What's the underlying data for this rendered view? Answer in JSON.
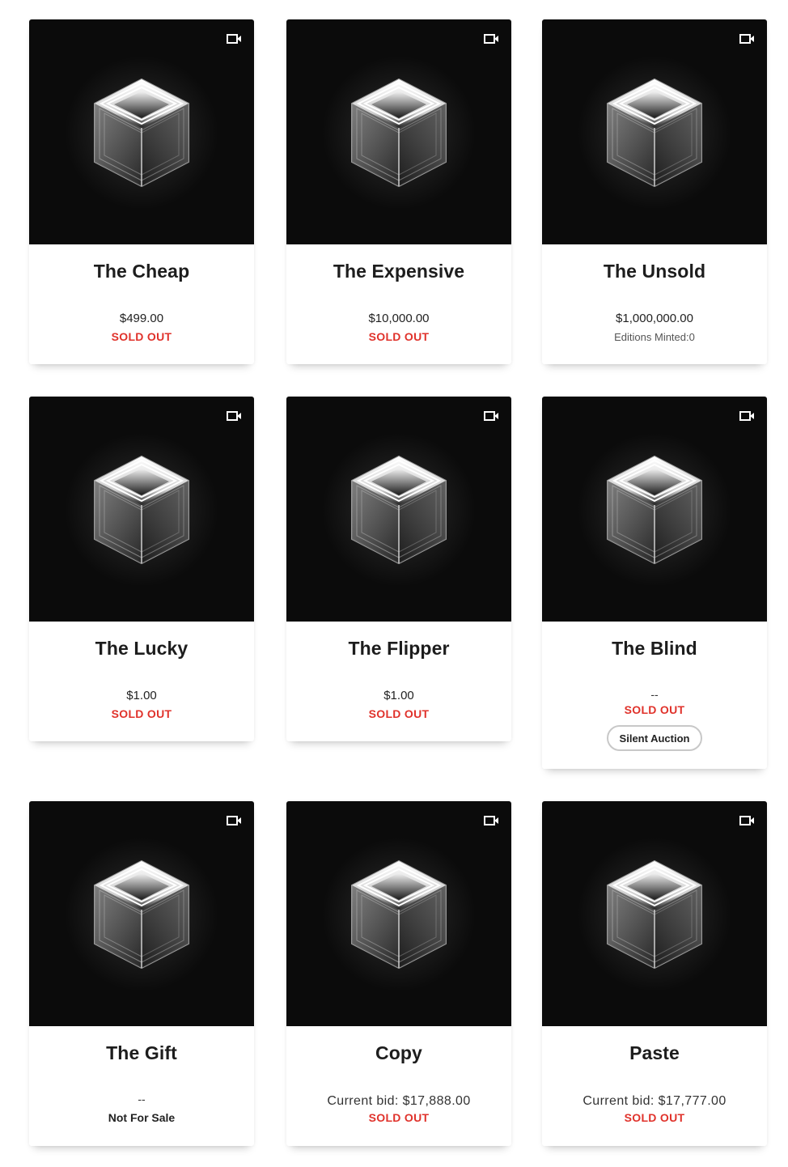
{
  "items": [
    {
      "title": "The Cheap",
      "price": "$499.00",
      "status": "SOLD OUT"
    },
    {
      "title": "The Expensive",
      "price": "$10,000.00",
      "status": "SOLD OUT"
    },
    {
      "title": "The Unsold",
      "price": "$1,000,000.00",
      "editions": "Editions Minted:0"
    },
    {
      "title": "The Lucky",
      "price": "$1.00",
      "status": "SOLD OUT"
    },
    {
      "title": "The Flipper",
      "price": "$1.00",
      "status": "SOLD OUT"
    },
    {
      "title": "The Blind",
      "price": "--",
      "status": "SOLD OUT",
      "tag": "Silent Auction"
    },
    {
      "title": "The Gift",
      "price": "--",
      "availability": "Not For Sale"
    },
    {
      "title": "Copy",
      "bid": "Current bid: $17,888.00",
      "status": "SOLD OUT"
    },
    {
      "title": "Paste",
      "bid": "Current bid: $17,777.00",
      "status": "SOLD OUT"
    }
  ],
  "icons": {
    "media": "video-camera-icon",
    "artwork": "glowing-cube-artwork"
  },
  "colors": {
    "sold_out": "#e0322b",
    "media_bg": "#0b0b0b"
  }
}
